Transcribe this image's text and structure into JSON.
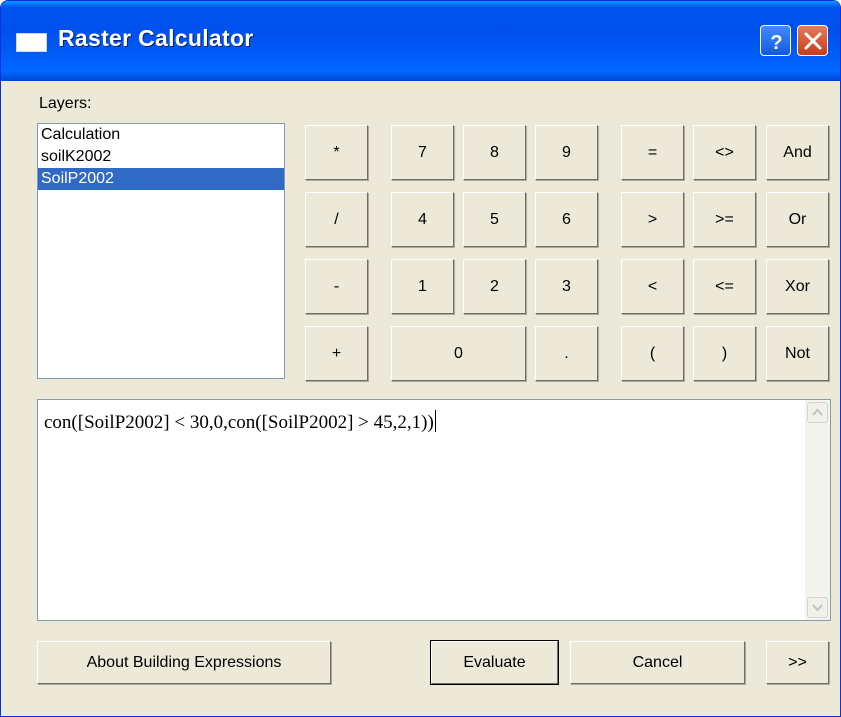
{
  "window": {
    "title": "Raster Calculator",
    "help_label": "?",
    "close_label": "×"
  },
  "layers": {
    "label": "Layers:",
    "items": [
      "Calculation",
      "soilK2002",
      "SoilP2002"
    ],
    "selected": "SoilP2002"
  },
  "operators": {
    "multiply": "*",
    "divide": "/",
    "subtract": "-",
    "add": "+"
  },
  "digits": {
    "seven": "7",
    "eight": "8",
    "nine": "9",
    "four": "4",
    "five": "5",
    "six": "6",
    "one": "1",
    "two": "2",
    "three": "3",
    "zero": "0",
    "decimal": "."
  },
  "comparisons": {
    "equal": "=",
    "not_equal": "<>",
    "greater": ">",
    "greater_equal": ">=",
    "less": "<",
    "less_equal": "<=",
    "open_paren": "(",
    "close_paren": ")"
  },
  "logical": {
    "and": "And",
    "or": "Or",
    "xor": "Xor",
    "not": "Not"
  },
  "expression": {
    "text": "con([SoilP2002] < 30,0,con([SoilP2002] > 45,2,1))"
  },
  "footer": {
    "about": "About Building Expressions",
    "evaluate": "Evaluate",
    "cancel": "Cancel",
    "more": ">>"
  }
}
